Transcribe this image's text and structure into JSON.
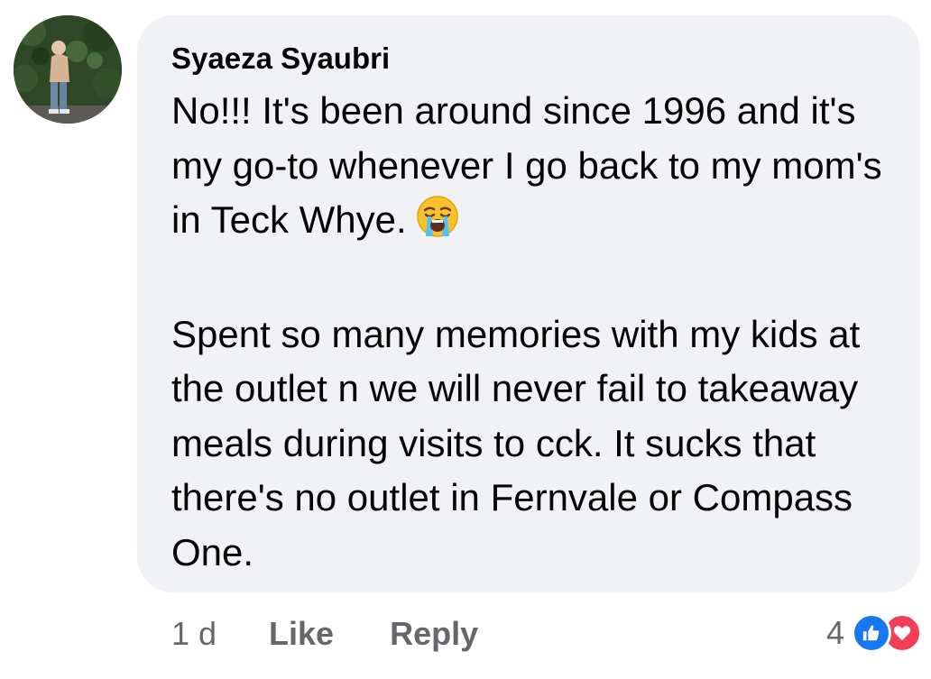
{
  "comment": {
    "author": "Syaeza Syaubri",
    "paragraph1": "No!!! It's been around since 1996 and it's my go-to whenever I go back to my mom's in Teck Whye.",
    "emoji": "loudly-crying-face-emoji",
    "paragraph2": "Spent so many memories with my kids at the outlet n we will never fail to takeaway meals during visits to cck. It sucks that there's no outlet in Fernvale or Compass One."
  },
  "actions": {
    "timestamp": "1 d",
    "like_label": "Like",
    "reply_label": "Reply"
  },
  "reactions": {
    "count": "4",
    "icons": [
      "like-reaction-icon",
      "love-reaction-icon"
    ]
  },
  "colors": {
    "bubble_bg": "#f0f2f5",
    "text": "#050505",
    "secondary_text": "#65676b",
    "like_blue": "#1877f2",
    "love_red": "#f33e58"
  }
}
